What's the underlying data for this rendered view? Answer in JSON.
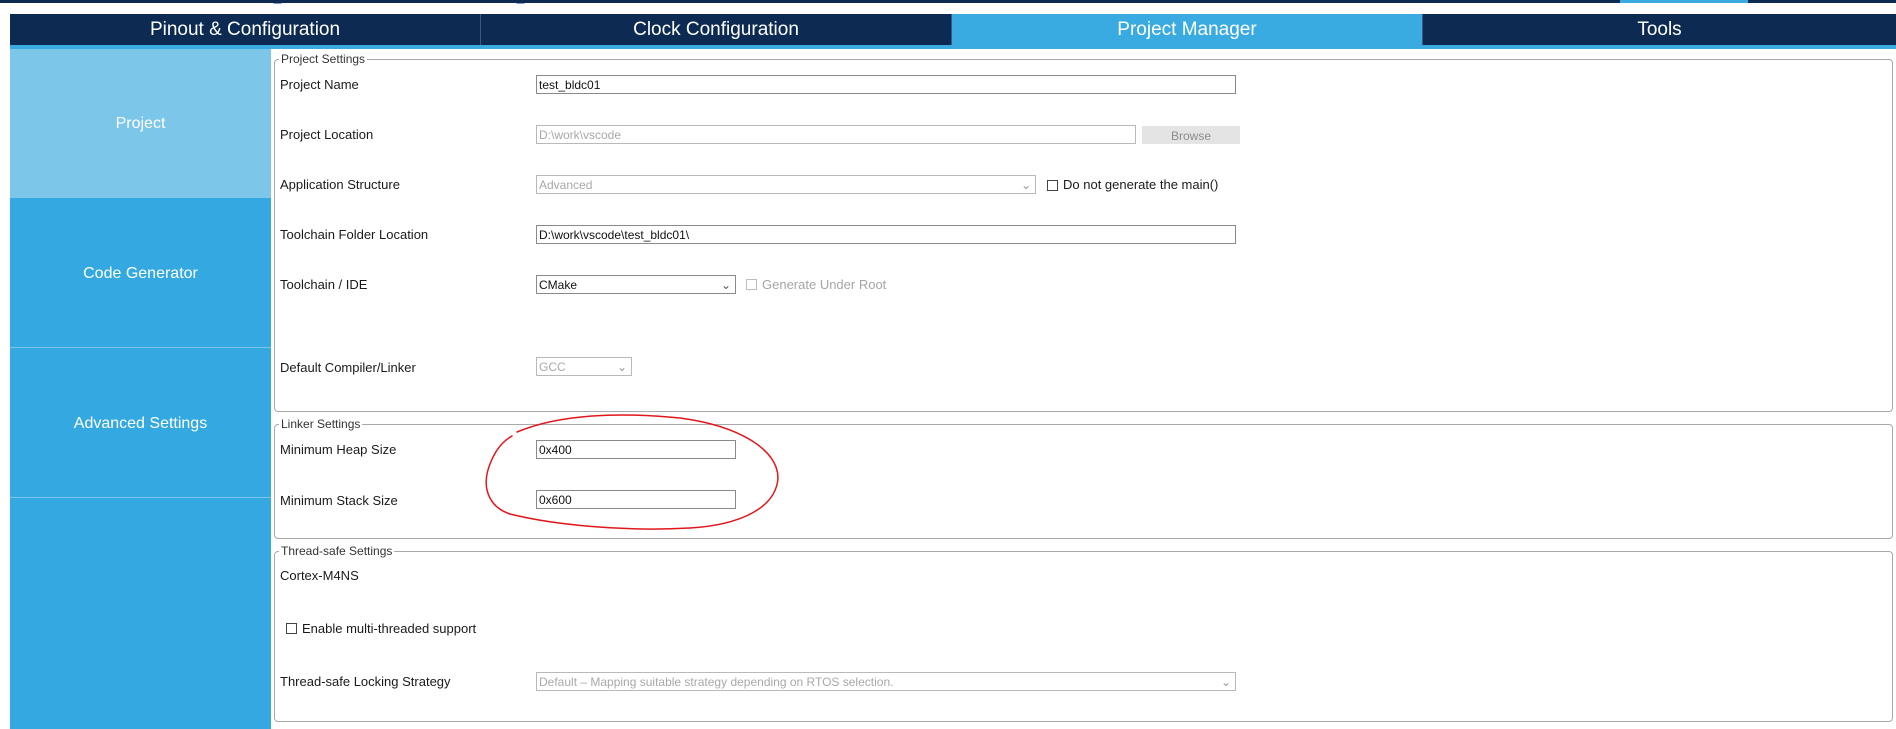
{
  "tabs": [
    {
      "label": "Pinout & Configuration",
      "active": false
    },
    {
      "label": "Clock Configuration",
      "active": false
    },
    {
      "label": "Project Manager",
      "active": true
    },
    {
      "label": "Tools",
      "active": false
    }
  ],
  "sidebar": {
    "items": [
      {
        "label": "Project",
        "active": true
      },
      {
        "label": "Code Generator",
        "active": false
      },
      {
        "label": "Advanced Settings",
        "active": false
      },
      {
        "label": "",
        "active": false
      }
    ]
  },
  "project_settings": {
    "legend": "Project Settings",
    "project_name": {
      "label": "Project Name",
      "value": "test_bldc01"
    },
    "project_location": {
      "label": "Project Location",
      "value": "D:\\work\\vscode",
      "button": "Browse"
    },
    "application_structure": {
      "label": "Application Structure",
      "value": "Advanced",
      "checkbox_label": "Do not generate the main()",
      "checked": false
    },
    "toolchain_folder": {
      "label": "Toolchain Folder Location",
      "value": "D:\\work\\vscode\\test_bldc01\\"
    },
    "toolchain_ide": {
      "label": "Toolchain / IDE",
      "value": "CMake",
      "checkbox_label": "Generate Under Root",
      "checked": false
    },
    "default_compiler": {
      "label": "Default Compiler/Linker",
      "value": "GCC"
    }
  },
  "linker_settings": {
    "legend": "Linker Settings",
    "heap": {
      "label": "Minimum Heap Size",
      "value": "0x400"
    },
    "stack": {
      "label": "Minimum Stack Size",
      "value": "0x600"
    }
  },
  "thread_safe_settings": {
    "legend": "Thread-safe Settings",
    "core": "Cortex-M4NS",
    "multithread": {
      "label": "Enable multi-threaded support",
      "checked": false
    },
    "locking_strategy": {
      "label": "Thread-safe Locking Strategy",
      "value": "Default – Mapping suitable strategy depending on RTOS selection."
    }
  },
  "icons": {
    "dropdown": "chevron-down-icon",
    "checkbox": "checkbox-icon"
  },
  "colors": {
    "tab_bg": "#0c2a52",
    "tab_active": "#3aabe0",
    "sidebar_bg": "#34a8e0",
    "sidebar_active": "#7cc6ea",
    "annotation": "#e0161b"
  }
}
